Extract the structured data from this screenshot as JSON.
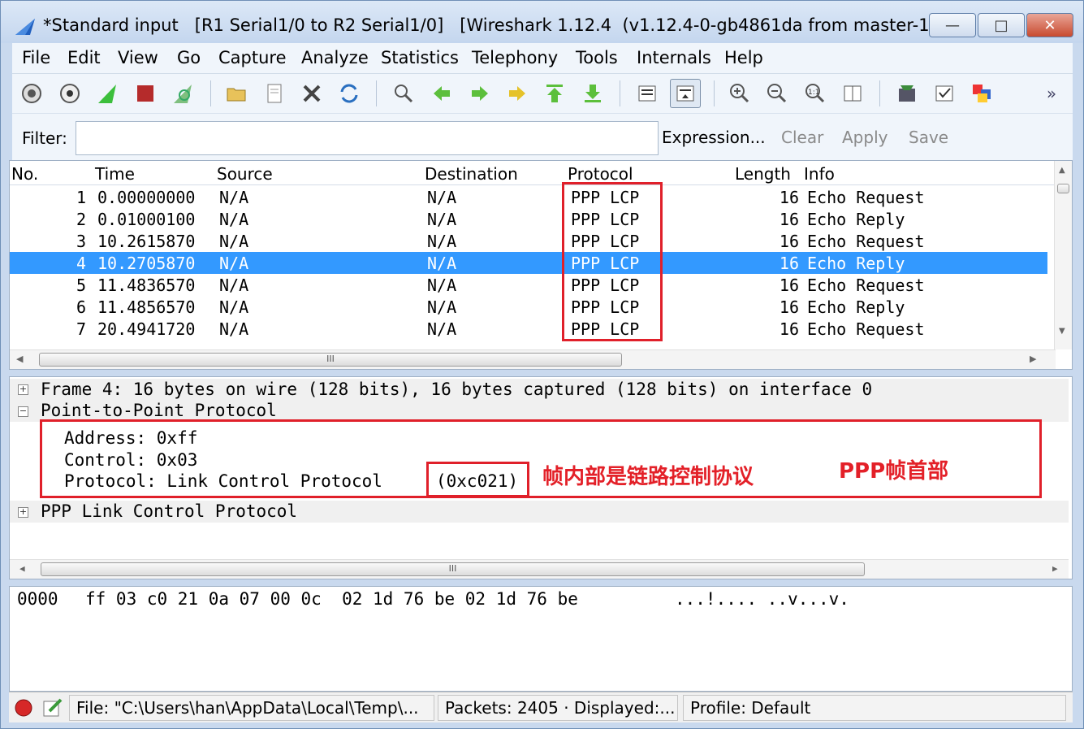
{
  "window": {
    "title": "*Standard input   [R1 Serial1/0 to R2 Serial1/0]   [Wireshark 1.12.4  (v1.12.4-0-gb4861da from master-1...",
    "minimize": "—",
    "maximize": "□",
    "close": "✕"
  },
  "menu": [
    "File",
    "Edit",
    "View",
    "Go",
    "Capture",
    "Analyze",
    "Statistics",
    "Telephony",
    "Tools",
    "Internals",
    "Help"
  ],
  "filter": {
    "label": "Filter:",
    "value": "",
    "expression": "Expression...",
    "clear": "Clear",
    "apply": "Apply",
    "save": "Save"
  },
  "columns": [
    "No.",
    "Time",
    "Source",
    "Destination",
    "Protocol",
    "Length",
    "Info"
  ],
  "packets": [
    {
      "no": "1",
      "time": "0.00000000",
      "src": "N/A",
      "dst": "N/A",
      "proto": "PPP LCP",
      "len": "16",
      "info": "Echo Request"
    },
    {
      "no": "2",
      "time": "0.01000100",
      "src": "N/A",
      "dst": "N/A",
      "proto": "PPP LCP",
      "len": "16",
      "info": "Echo Reply"
    },
    {
      "no": "3",
      "time": "10.2615870",
      "src": "N/A",
      "dst": "N/A",
      "proto": "PPP LCP",
      "len": "16",
      "info": "Echo Request"
    },
    {
      "no": "4",
      "time": "10.2705870",
      "src": "N/A",
      "dst": "N/A",
      "proto": "PPP LCP",
      "len": "16",
      "info": "Echo Reply"
    },
    {
      "no": "5",
      "time": "11.4836570",
      "src": "N/A",
      "dst": "N/A",
      "proto": "PPP LCP",
      "len": "16",
      "info": "Echo Request"
    },
    {
      "no": "6",
      "time": "11.4856570",
      "src": "N/A",
      "dst": "N/A",
      "proto": "PPP LCP",
      "len": "16",
      "info": "Echo Reply"
    },
    {
      "no": "7",
      "time": "20.4941720",
      "src": "N/A",
      "dst": "N/A",
      "proto": "PPP LCP",
      "len": "16",
      "info": "Echo Request"
    }
  ],
  "hscroll_label": "III",
  "detail": {
    "frame": "Frame 4: 16 bytes on wire (128 bits), 16 bytes captured (128 bits) on interface 0",
    "ppp": "Point-to-Point Protocol",
    "address": "Address: 0xff",
    "control": "Control: 0x03",
    "protocol": "Protocol: Link Control Protocol",
    "protocol_code": "(0xc021)",
    "lcp": "PPP Link Control Protocol"
  },
  "annotations": {
    "inner": "帧内部是链路控制协议",
    "header": "PPP帧首部"
  },
  "hex": {
    "offset": "0000",
    "bytes": "ff 03 c0 21 0a 07 00 0c  02 1d 76 be 02 1d 76 be",
    "ascii": "...!.... ..v...v."
  },
  "status": {
    "file": "File: \"C:\\Users\\han\\AppData\\Local\\Temp\\...",
    "packets": "Packets: 2405 · Displayed:...",
    "profile": "Profile: Default"
  },
  "colors": {
    "selection": "#3399ff",
    "annotation": "#e32028"
  }
}
